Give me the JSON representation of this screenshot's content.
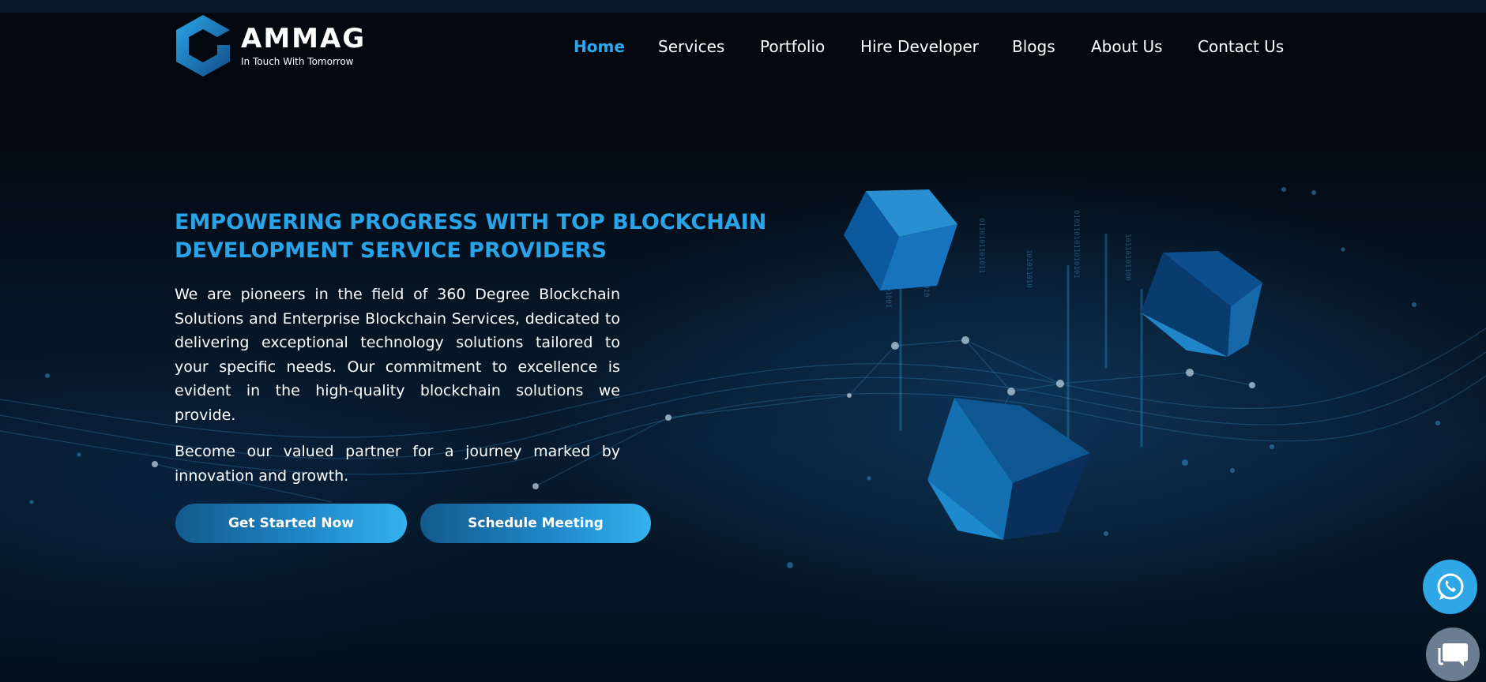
{
  "brand": {
    "name": "AMMAG",
    "tagline": "In Touch With Tomorrow",
    "logo_icon": "hexagon-logo-icon"
  },
  "nav": {
    "items": [
      {
        "label": "Home",
        "active": true
      },
      {
        "label": "Services",
        "active": false
      },
      {
        "label": "Portfolio",
        "active": false
      },
      {
        "label": "Hire Developer",
        "active": false
      },
      {
        "label": "Blogs",
        "active": false
      },
      {
        "label": "About Us",
        "active": false
      },
      {
        "label": "Contact Us",
        "active": false
      }
    ]
  },
  "hero": {
    "heading": "EMPOWERING PROGRESS WITH TOP BLOCKCHAIN DEVELOPMENT SERVICE PROVIDERS",
    "paragraph1": "We are pioneers in the field of 360 Degree Blockchain Solutions and Enterprise Blockchain Services, dedicated to delivering exceptional technology solutions tailored to your specific needs. Our commitment to excellence is evident in the high-quality blockchain solutions we provide.",
    "paragraph2": "Become our valued partner for a journey marked by innovation and growth.",
    "primary_button": "Get Started Now",
    "secondary_button": "Schedule Meeting"
  },
  "floating": {
    "whatsapp_icon": "whatsapp-icon",
    "chat_icon": "chat-bubble-icon"
  },
  "colors": {
    "accent": "#2aa4e8",
    "background": "#05101d",
    "button_start": "#135a8c",
    "button_end": "#33b2ee",
    "whatsapp_bg": "#2fa6e6",
    "chat_bg": "#6b7d93"
  }
}
